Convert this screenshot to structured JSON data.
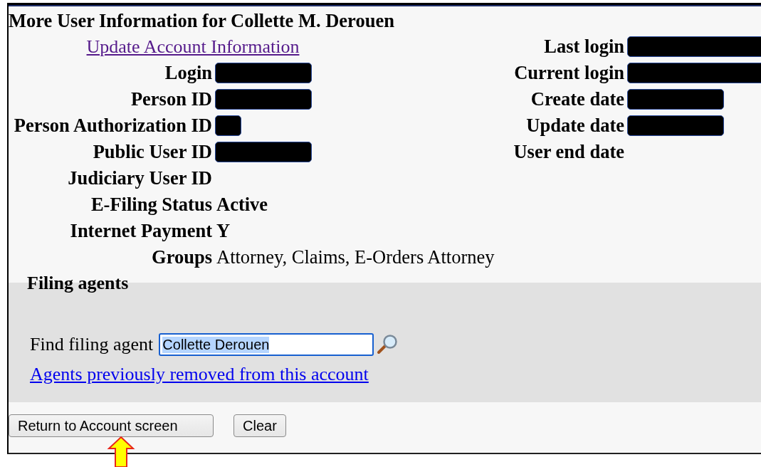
{
  "title": "More User Information for Collette M. Derouen",
  "account_link": {
    "text": "Update Account Information",
    "visited": true
  },
  "left_fields": [
    {
      "label": "Login",
      "kind": "redacted"
    },
    {
      "label": "Person ID",
      "kind": "redacted"
    },
    {
      "label": "Person Authorization ID",
      "kind": "redacted_short"
    },
    {
      "label": "Public User ID",
      "kind": "redacted"
    },
    {
      "label": "Judiciary User ID",
      "kind": "empty"
    },
    {
      "label": "E-Filing Status",
      "kind": "bold",
      "value": "Active"
    },
    {
      "label": "Internet Payment",
      "kind": "bold",
      "value": "Y"
    },
    {
      "label": "Groups",
      "kind": "plain",
      "value": "Attorney, Claims, E-Orders Attorney"
    }
  ],
  "right_fields": [
    {
      "label": "Last login",
      "kind": "redacted_long"
    },
    {
      "label": "Current login",
      "kind": "redacted_long"
    },
    {
      "label": "Create date",
      "kind": "redacted"
    },
    {
      "label": "Update date",
      "kind": "redacted"
    },
    {
      "label": "User end date",
      "kind": "empty"
    }
  ],
  "filing_agents": {
    "heading": "Filing agents",
    "find_label": "Find filing agent",
    "find_value": "Collette Derouen",
    "value_selected": true,
    "removed_link": {
      "text": "Agents previously removed from this account",
      "visited": false
    }
  },
  "buttons": [
    "Return to Account screen",
    "Clear"
  ]
}
